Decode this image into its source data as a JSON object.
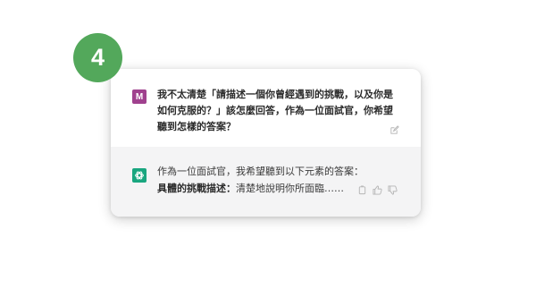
{
  "step": {
    "number": "4",
    "color": "#53a85b"
  },
  "user_message": {
    "avatar_letter": "M",
    "avatar_color": "#a0418e",
    "text": "我不太清楚「請描述一個你曾經遇到的挑戰，以及你是如何克服的？」該怎麼回答，作為一位面試官，你希望聽到怎樣的答案？",
    "edit_icon": "edit-icon"
  },
  "assistant_message": {
    "icon": "openai-logo-icon",
    "icon_color": "#19a67f",
    "intro": "作為一位面試官，我希望聽到以下元素的答案：",
    "point_title": "具體的挑戰描述：",
    "point_text": "清楚地說明你所面臨……",
    "actions": [
      "copy-icon",
      "thumbs-up-icon",
      "thumbs-down-icon"
    ]
  }
}
